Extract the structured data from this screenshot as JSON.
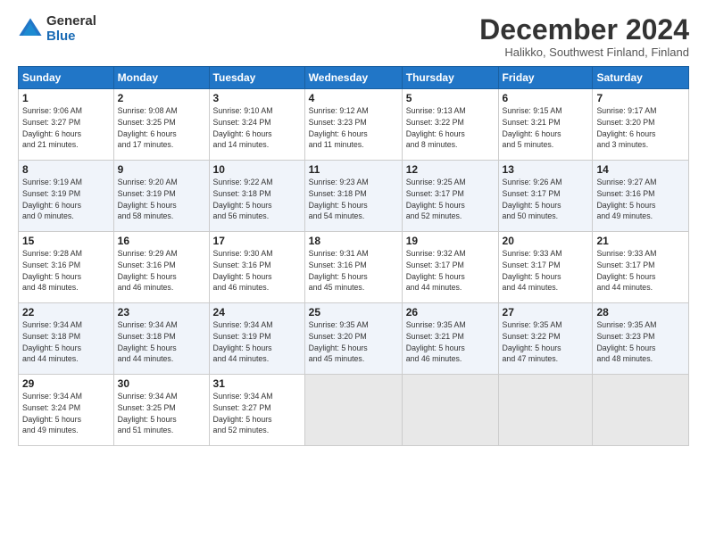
{
  "logo": {
    "general": "General",
    "blue": "Blue"
  },
  "title": "December 2024",
  "subtitle": "Halikko, Southwest Finland, Finland",
  "header_days": [
    "Sunday",
    "Monday",
    "Tuesday",
    "Wednesday",
    "Thursday",
    "Friday",
    "Saturday"
  ],
  "weeks": [
    [
      {
        "day": "1",
        "info": "Sunrise: 9:06 AM\nSunset: 3:27 PM\nDaylight: 6 hours\nand 21 minutes."
      },
      {
        "day": "2",
        "info": "Sunrise: 9:08 AM\nSunset: 3:25 PM\nDaylight: 6 hours\nand 17 minutes."
      },
      {
        "day": "3",
        "info": "Sunrise: 9:10 AM\nSunset: 3:24 PM\nDaylight: 6 hours\nand 14 minutes."
      },
      {
        "day": "4",
        "info": "Sunrise: 9:12 AM\nSunset: 3:23 PM\nDaylight: 6 hours\nand 11 minutes."
      },
      {
        "day": "5",
        "info": "Sunrise: 9:13 AM\nSunset: 3:22 PM\nDaylight: 6 hours\nand 8 minutes."
      },
      {
        "day": "6",
        "info": "Sunrise: 9:15 AM\nSunset: 3:21 PM\nDaylight: 6 hours\nand 5 minutes."
      },
      {
        "day": "7",
        "info": "Sunrise: 9:17 AM\nSunset: 3:20 PM\nDaylight: 6 hours\nand 3 minutes."
      }
    ],
    [
      {
        "day": "8",
        "info": "Sunrise: 9:19 AM\nSunset: 3:19 PM\nDaylight: 6 hours\nand 0 minutes."
      },
      {
        "day": "9",
        "info": "Sunrise: 9:20 AM\nSunset: 3:19 PM\nDaylight: 5 hours\nand 58 minutes."
      },
      {
        "day": "10",
        "info": "Sunrise: 9:22 AM\nSunset: 3:18 PM\nDaylight: 5 hours\nand 56 minutes."
      },
      {
        "day": "11",
        "info": "Sunrise: 9:23 AM\nSunset: 3:18 PM\nDaylight: 5 hours\nand 54 minutes."
      },
      {
        "day": "12",
        "info": "Sunrise: 9:25 AM\nSunset: 3:17 PM\nDaylight: 5 hours\nand 52 minutes."
      },
      {
        "day": "13",
        "info": "Sunrise: 9:26 AM\nSunset: 3:17 PM\nDaylight: 5 hours\nand 50 minutes."
      },
      {
        "day": "14",
        "info": "Sunrise: 9:27 AM\nSunset: 3:16 PM\nDaylight: 5 hours\nand 49 minutes."
      }
    ],
    [
      {
        "day": "15",
        "info": "Sunrise: 9:28 AM\nSunset: 3:16 PM\nDaylight: 5 hours\nand 48 minutes."
      },
      {
        "day": "16",
        "info": "Sunrise: 9:29 AM\nSunset: 3:16 PM\nDaylight: 5 hours\nand 46 minutes."
      },
      {
        "day": "17",
        "info": "Sunrise: 9:30 AM\nSunset: 3:16 PM\nDaylight: 5 hours\nand 46 minutes."
      },
      {
        "day": "18",
        "info": "Sunrise: 9:31 AM\nSunset: 3:16 PM\nDaylight: 5 hours\nand 45 minutes."
      },
      {
        "day": "19",
        "info": "Sunrise: 9:32 AM\nSunset: 3:17 PM\nDaylight: 5 hours\nand 44 minutes."
      },
      {
        "day": "20",
        "info": "Sunrise: 9:33 AM\nSunset: 3:17 PM\nDaylight: 5 hours\nand 44 minutes."
      },
      {
        "day": "21",
        "info": "Sunrise: 9:33 AM\nSunset: 3:17 PM\nDaylight: 5 hours\nand 44 minutes."
      }
    ],
    [
      {
        "day": "22",
        "info": "Sunrise: 9:34 AM\nSunset: 3:18 PM\nDaylight: 5 hours\nand 44 minutes."
      },
      {
        "day": "23",
        "info": "Sunrise: 9:34 AM\nSunset: 3:18 PM\nDaylight: 5 hours\nand 44 minutes."
      },
      {
        "day": "24",
        "info": "Sunrise: 9:34 AM\nSunset: 3:19 PM\nDaylight: 5 hours\nand 44 minutes."
      },
      {
        "day": "25",
        "info": "Sunrise: 9:35 AM\nSunset: 3:20 PM\nDaylight: 5 hours\nand 45 minutes."
      },
      {
        "day": "26",
        "info": "Sunrise: 9:35 AM\nSunset: 3:21 PM\nDaylight: 5 hours\nand 46 minutes."
      },
      {
        "day": "27",
        "info": "Sunrise: 9:35 AM\nSunset: 3:22 PM\nDaylight: 5 hours\nand 47 minutes."
      },
      {
        "day": "28",
        "info": "Sunrise: 9:35 AM\nSunset: 3:23 PM\nDaylight: 5 hours\nand 48 minutes."
      }
    ],
    [
      {
        "day": "29",
        "info": "Sunrise: 9:34 AM\nSunset: 3:24 PM\nDaylight: 5 hours\nand 49 minutes."
      },
      {
        "day": "30",
        "info": "Sunrise: 9:34 AM\nSunset: 3:25 PM\nDaylight: 5 hours\nand 51 minutes."
      },
      {
        "day": "31",
        "info": "Sunrise: 9:34 AM\nSunset: 3:27 PM\nDaylight: 5 hours\nand 52 minutes."
      },
      null,
      null,
      null,
      null
    ]
  ]
}
